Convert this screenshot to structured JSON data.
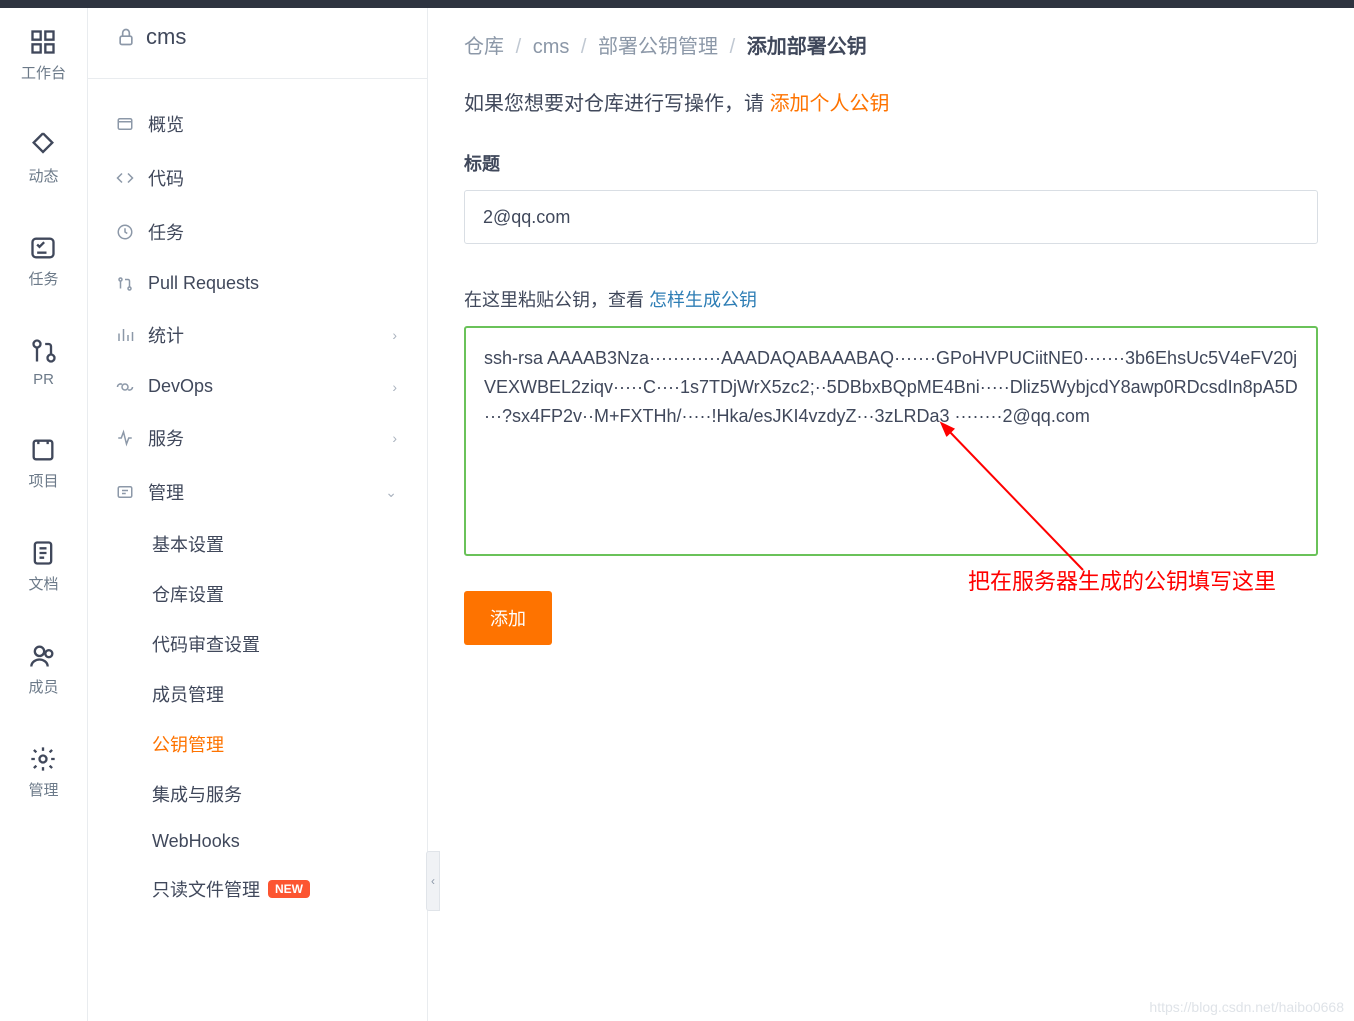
{
  "leftnav": {
    "items": [
      {
        "label": "工作台",
        "icon": "dashboard-icon"
      },
      {
        "label": "动态",
        "icon": "activity-icon"
      },
      {
        "label": "任务",
        "icon": "task-icon"
      },
      {
        "label": "PR",
        "icon": "pr-icon"
      },
      {
        "label": "项目",
        "icon": "project-icon"
      },
      {
        "label": "文档",
        "icon": "docs-icon"
      },
      {
        "label": "成员",
        "icon": "members-icon"
      },
      {
        "label": "管理",
        "icon": "settings-icon"
      }
    ]
  },
  "repo": {
    "name": "cms"
  },
  "menu": {
    "overview": "概览",
    "code": "代码",
    "tasks": "任务",
    "pr": "Pull Requests",
    "stats": "统计",
    "devops": "DevOps",
    "services": "服务",
    "manage": "管理"
  },
  "submenu": {
    "basic": "基本设置",
    "repo": "仓库设置",
    "review": "代码审查设置",
    "members": "成员管理",
    "keys": "公钥管理",
    "integrations": "集成与服务",
    "webhooks": "WebHooks",
    "readonly": "只读文件管理",
    "newbadge": "NEW"
  },
  "breadcrumb": {
    "repo": "仓库",
    "cms": "cms",
    "deploy": "部署公钥管理",
    "current": "添加部署公钥"
  },
  "hint": {
    "prefix": "如果您想要对仓库进行写操作，请 ",
    "link": "添加个人公钥"
  },
  "form": {
    "title_label": "标题",
    "title_value": "2@qq.com",
    "paste_prefix": "在这里粘贴公钥，查看 ",
    "paste_link": "怎样生成公钥",
    "key_value": "ssh-rsa AAAAB3Nza············AAADAQABAAABAQ·······GPoHVPUCiitNE0·······3b6EhsUc5V4eFV20jVEXWBEL2ziqv·····C····1s7TDjWrX5zc2;··5DBbxBQpME4Bni·····Dliz5WybjcdY8awp0RDcsdIn8pA5D···?sx4FP2v··M+FXTHh/·····!Hka/esJKI4vzdyZ···3zLRDa3 ········2@qq.com",
    "submit": "添加"
  },
  "annotation": "把在服务器生成的公钥填写这里",
  "watermark": "https://blog.csdn.net/haibo0668"
}
